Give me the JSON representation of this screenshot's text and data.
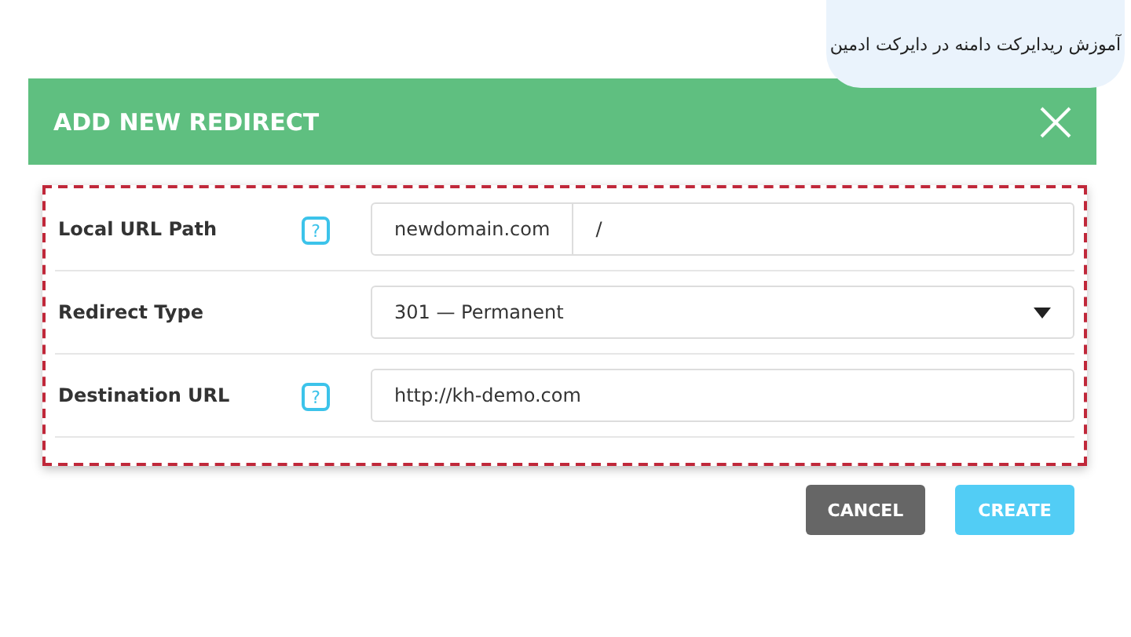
{
  "caption": "آموزش ریدایرکت دامنه در دایرکت ادمین",
  "dialog": {
    "title": "ADD NEW REDIRECT"
  },
  "fields": [
    {
      "label": "Local URL Path",
      "help": "?",
      "kind": "split",
      "prefix": "newdomain.com",
      "value": "/"
    },
    {
      "label": "Redirect Type",
      "kind": "select",
      "value": "301 — Permanent"
    },
    {
      "label": "Destination URL",
      "help": "?",
      "kind": "text",
      "value": "http://kh-demo.com"
    }
  ],
  "buttons": [
    {
      "label": "CANCEL",
      "kind": "secondary"
    },
    {
      "label": "CREATE",
      "kind": "primary"
    }
  ]
}
